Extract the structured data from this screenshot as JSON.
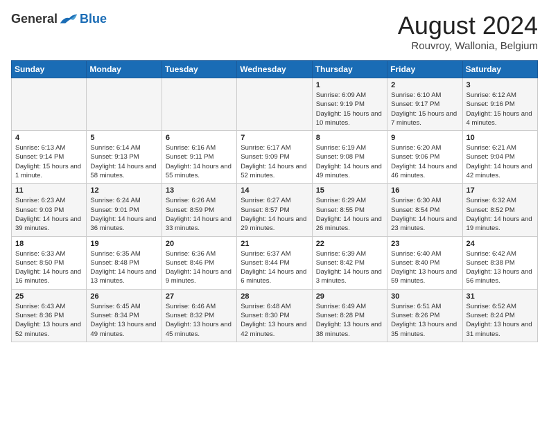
{
  "logo": {
    "general": "General",
    "blue": "Blue"
  },
  "title": "August 2024",
  "subtitle": "Rouvroy, Wallonia, Belgium",
  "days_header": [
    "Sunday",
    "Monday",
    "Tuesday",
    "Wednesday",
    "Thursday",
    "Friday",
    "Saturday"
  ],
  "weeks": [
    [
      {
        "day": "",
        "info": ""
      },
      {
        "day": "",
        "info": ""
      },
      {
        "day": "",
        "info": ""
      },
      {
        "day": "",
        "info": ""
      },
      {
        "day": "1",
        "info": "Sunrise: 6:09 AM\nSunset: 9:19 PM\nDaylight: 15 hours\nand 10 minutes."
      },
      {
        "day": "2",
        "info": "Sunrise: 6:10 AM\nSunset: 9:17 PM\nDaylight: 15 hours\nand 7 minutes."
      },
      {
        "day": "3",
        "info": "Sunrise: 6:12 AM\nSunset: 9:16 PM\nDaylight: 15 hours\nand 4 minutes."
      }
    ],
    [
      {
        "day": "4",
        "info": "Sunrise: 6:13 AM\nSunset: 9:14 PM\nDaylight: 15 hours\nand 1 minute."
      },
      {
        "day": "5",
        "info": "Sunrise: 6:14 AM\nSunset: 9:13 PM\nDaylight: 14 hours\nand 58 minutes."
      },
      {
        "day": "6",
        "info": "Sunrise: 6:16 AM\nSunset: 9:11 PM\nDaylight: 14 hours\nand 55 minutes."
      },
      {
        "day": "7",
        "info": "Sunrise: 6:17 AM\nSunset: 9:09 PM\nDaylight: 14 hours\nand 52 minutes."
      },
      {
        "day": "8",
        "info": "Sunrise: 6:19 AM\nSunset: 9:08 PM\nDaylight: 14 hours\nand 49 minutes."
      },
      {
        "day": "9",
        "info": "Sunrise: 6:20 AM\nSunset: 9:06 PM\nDaylight: 14 hours\nand 46 minutes."
      },
      {
        "day": "10",
        "info": "Sunrise: 6:21 AM\nSunset: 9:04 PM\nDaylight: 14 hours\nand 42 minutes."
      }
    ],
    [
      {
        "day": "11",
        "info": "Sunrise: 6:23 AM\nSunset: 9:03 PM\nDaylight: 14 hours\nand 39 minutes."
      },
      {
        "day": "12",
        "info": "Sunrise: 6:24 AM\nSunset: 9:01 PM\nDaylight: 14 hours\nand 36 minutes."
      },
      {
        "day": "13",
        "info": "Sunrise: 6:26 AM\nSunset: 8:59 PM\nDaylight: 14 hours\nand 33 minutes."
      },
      {
        "day": "14",
        "info": "Sunrise: 6:27 AM\nSunset: 8:57 PM\nDaylight: 14 hours\nand 29 minutes."
      },
      {
        "day": "15",
        "info": "Sunrise: 6:29 AM\nSunset: 8:55 PM\nDaylight: 14 hours\nand 26 minutes."
      },
      {
        "day": "16",
        "info": "Sunrise: 6:30 AM\nSunset: 8:54 PM\nDaylight: 14 hours\nand 23 minutes."
      },
      {
        "day": "17",
        "info": "Sunrise: 6:32 AM\nSunset: 8:52 PM\nDaylight: 14 hours\nand 19 minutes."
      }
    ],
    [
      {
        "day": "18",
        "info": "Sunrise: 6:33 AM\nSunset: 8:50 PM\nDaylight: 14 hours\nand 16 minutes."
      },
      {
        "day": "19",
        "info": "Sunrise: 6:35 AM\nSunset: 8:48 PM\nDaylight: 14 hours\nand 13 minutes."
      },
      {
        "day": "20",
        "info": "Sunrise: 6:36 AM\nSunset: 8:46 PM\nDaylight: 14 hours\nand 9 minutes."
      },
      {
        "day": "21",
        "info": "Sunrise: 6:37 AM\nSunset: 8:44 PM\nDaylight: 14 hours\nand 6 minutes."
      },
      {
        "day": "22",
        "info": "Sunrise: 6:39 AM\nSunset: 8:42 PM\nDaylight: 14 hours\nand 3 minutes."
      },
      {
        "day": "23",
        "info": "Sunrise: 6:40 AM\nSunset: 8:40 PM\nDaylight: 13 hours\nand 59 minutes."
      },
      {
        "day": "24",
        "info": "Sunrise: 6:42 AM\nSunset: 8:38 PM\nDaylight: 13 hours\nand 56 minutes."
      }
    ],
    [
      {
        "day": "25",
        "info": "Sunrise: 6:43 AM\nSunset: 8:36 PM\nDaylight: 13 hours\nand 52 minutes."
      },
      {
        "day": "26",
        "info": "Sunrise: 6:45 AM\nSunset: 8:34 PM\nDaylight: 13 hours\nand 49 minutes."
      },
      {
        "day": "27",
        "info": "Sunrise: 6:46 AM\nSunset: 8:32 PM\nDaylight: 13 hours\nand 45 minutes."
      },
      {
        "day": "28",
        "info": "Sunrise: 6:48 AM\nSunset: 8:30 PM\nDaylight: 13 hours\nand 42 minutes."
      },
      {
        "day": "29",
        "info": "Sunrise: 6:49 AM\nSunset: 8:28 PM\nDaylight: 13 hours\nand 38 minutes."
      },
      {
        "day": "30",
        "info": "Sunrise: 6:51 AM\nSunset: 8:26 PM\nDaylight: 13 hours\nand 35 minutes."
      },
      {
        "day": "31",
        "info": "Sunrise: 6:52 AM\nSunset: 8:24 PM\nDaylight: 13 hours\nand 31 minutes."
      }
    ]
  ]
}
